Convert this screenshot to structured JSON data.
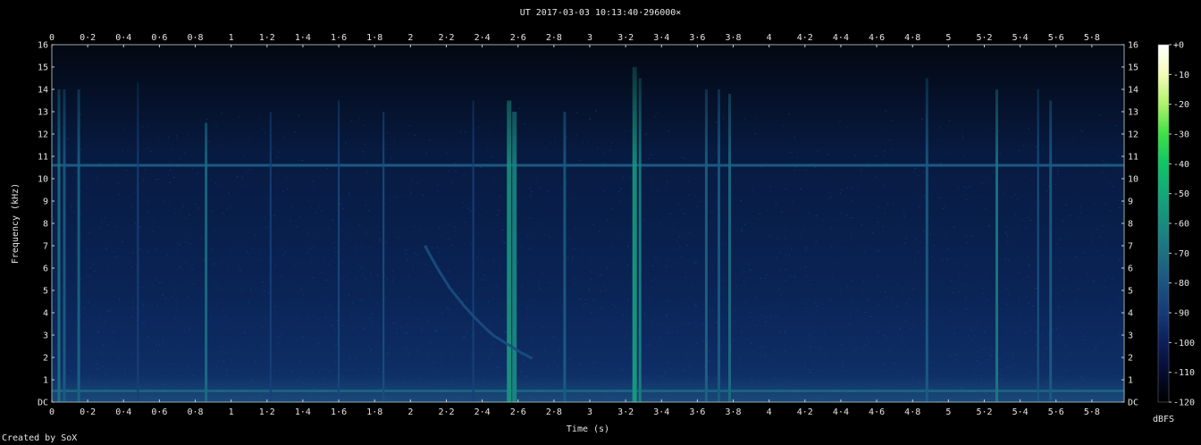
{
  "title": "UT 2017-03-03 10:13:40·296000×",
  "credit": "Created by SoX",
  "chart_data": {
    "type": "heatmap",
    "title": "UT 2017-03-03 10:13:40·296000×",
    "xlabel": "Time (s)",
    "ylabel": "Frequency (kHz)",
    "xlim": [
      0,
      5.98
    ],
    "ylim": [
      0,
      16
    ],
    "x_ticks": [
      "0",
      "0·2",
      "0·4",
      "0·6",
      "0·8",
      "1",
      "1·2",
      "1·4",
      "1·6",
      "1·8",
      "2",
      "2·2",
      "2·4",
      "2·6",
      "2·8",
      "3",
      "3·2",
      "3·4",
      "3·6",
      "3·8",
      "4",
      "4·2",
      "4·4",
      "4·6",
      "4·8",
      "5",
      "5·2",
      "5·4",
      "5·6",
      "5·8"
    ],
    "x_tick_values": [
      0,
      0.2,
      0.4,
      0.6,
      0.8,
      1,
      1.2,
      1.4,
      1.6,
      1.8,
      2,
      2.2,
      2.4,
      2.6,
      2.8,
      3,
      3.2,
      3.4,
      3.6,
      3.8,
      4,
      4.2,
      4.4,
      4.6,
      4.8,
      5,
      5.2,
      5.4,
      5.6,
      5.8
    ],
    "y_ticks": [
      "DC",
      "1",
      "2",
      "3",
      "4",
      "5",
      "6",
      "7",
      "8",
      "9",
      "10",
      "11",
      "12",
      "13",
      "14",
      "15",
      "16"
    ],
    "y_tick_values": [
      0,
      1,
      2,
      3,
      4,
      5,
      6,
      7,
      8,
      9,
      10,
      11,
      12,
      13,
      14,
      15,
      16
    ],
    "colorbar": {
      "label": "dBFS",
      "ticks": [
        "+0",
        "-10",
        "-20",
        "-30",
        "-40",
        "-50",
        "-60",
        "-70",
        "-80",
        "-90",
        "-100",
        "-110",
        "-120"
      ],
      "tick_values": [
        0,
        -10,
        -20,
        -30,
        -40,
        -50,
        -60,
        -70,
        -80,
        -90,
        -100,
        -110,
        -120
      ],
      "colors": [
        "#ffffff",
        "#f4fcb8",
        "#aef26a",
        "#3ee046",
        "#10c466",
        "#12a878",
        "#188c80",
        "#1c7082",
        "#1a5482",
        "#163a78",
        "#0c1e5c",
        "#050c30",
        "#000000"
      ]
    },
    "features": {
      "tone_line_khz": 10.6,
      "low_tone_khz": 0.5,
      "whistler_curve": [
        [
          2.08,
          7.0
        ],
        [
          2.15,
          6.0
        ],
        [
          2.22,
          5.1
        ],
        [
          2.3,
          4.3
        ],
        [
          2.38,
          3.6
        ],
        [
          2.46,
          3.0
        ],
        [
          2.54,
          2.6
        ],
        [
          2.62,
          2.2
        ],
        [
          2.68,
          1.95
        ]
      ],
      "sferics": [
        {
          "t": 0.04,
          "f_top": 14.0,
          "level": -70
        },
        {
          "t": 0.07,
          "f_top": 14.0,
          "level": -78
        },
        {
          "t": 0.15,
          "f_top": 14.0,
          "level": -75
        },
        {
          "t": 0.48,
          "f_top": 14.3,
          "level": -88
        },
        {
          "t": 0.86,
          "f_top": 12.5,
          "level": -72
        },
        {
          "t": 1.22,
          "f_top": 13.0,
          "level": -88
        },
        {
          "t": 1.6,
          "f_top": 13.5,
          "level": -85
        },
        {
          "t": 1.85,
          "f_top": 13.0,
          "level": -82
        },
        {
          "t": 2.35,
          "f_top": 13.5,
          "level": -88
        },
        {
          "t": 2.55,
          "f_top": 13.5,
          "level": -58
        },
        {
          "t": 2.58,
          "f_top": 13.0,
          "level": -62
        },
        {
          "t": 2.86,
          "f_top": 13.0,
          "level": -78
        },
        {
          "t": 3.25,
          "f_top": 15.0,
          "level": -55
        },
        {
          "t": 3.28,
          "f_top": 14.5,
          "level": -65
        },
        {
          "t": 3.65,
          "f_top": 14.0,
          "level": -75
        },
        {
          "t": 3.72,
          "f_top": 14.0,
          "level": -78
        },
        {
          "t": 3.78,
          "f_top": 13.8,
          "level": -72
        },
        {
          "t": 4.88,
          "f_top": 14.5,
          "level": -78
        },
        {
          "t": 5.27,
          "f_top": 14.0,
          "level": -68
        },
        {
          "t": 5.5,
          "f_top": 14.0,
          "level": -80
        },
        {
          "t": 5.57,
          "f_top": 13.5,
          "level": -78
        }
      ]
    }
  }
}
